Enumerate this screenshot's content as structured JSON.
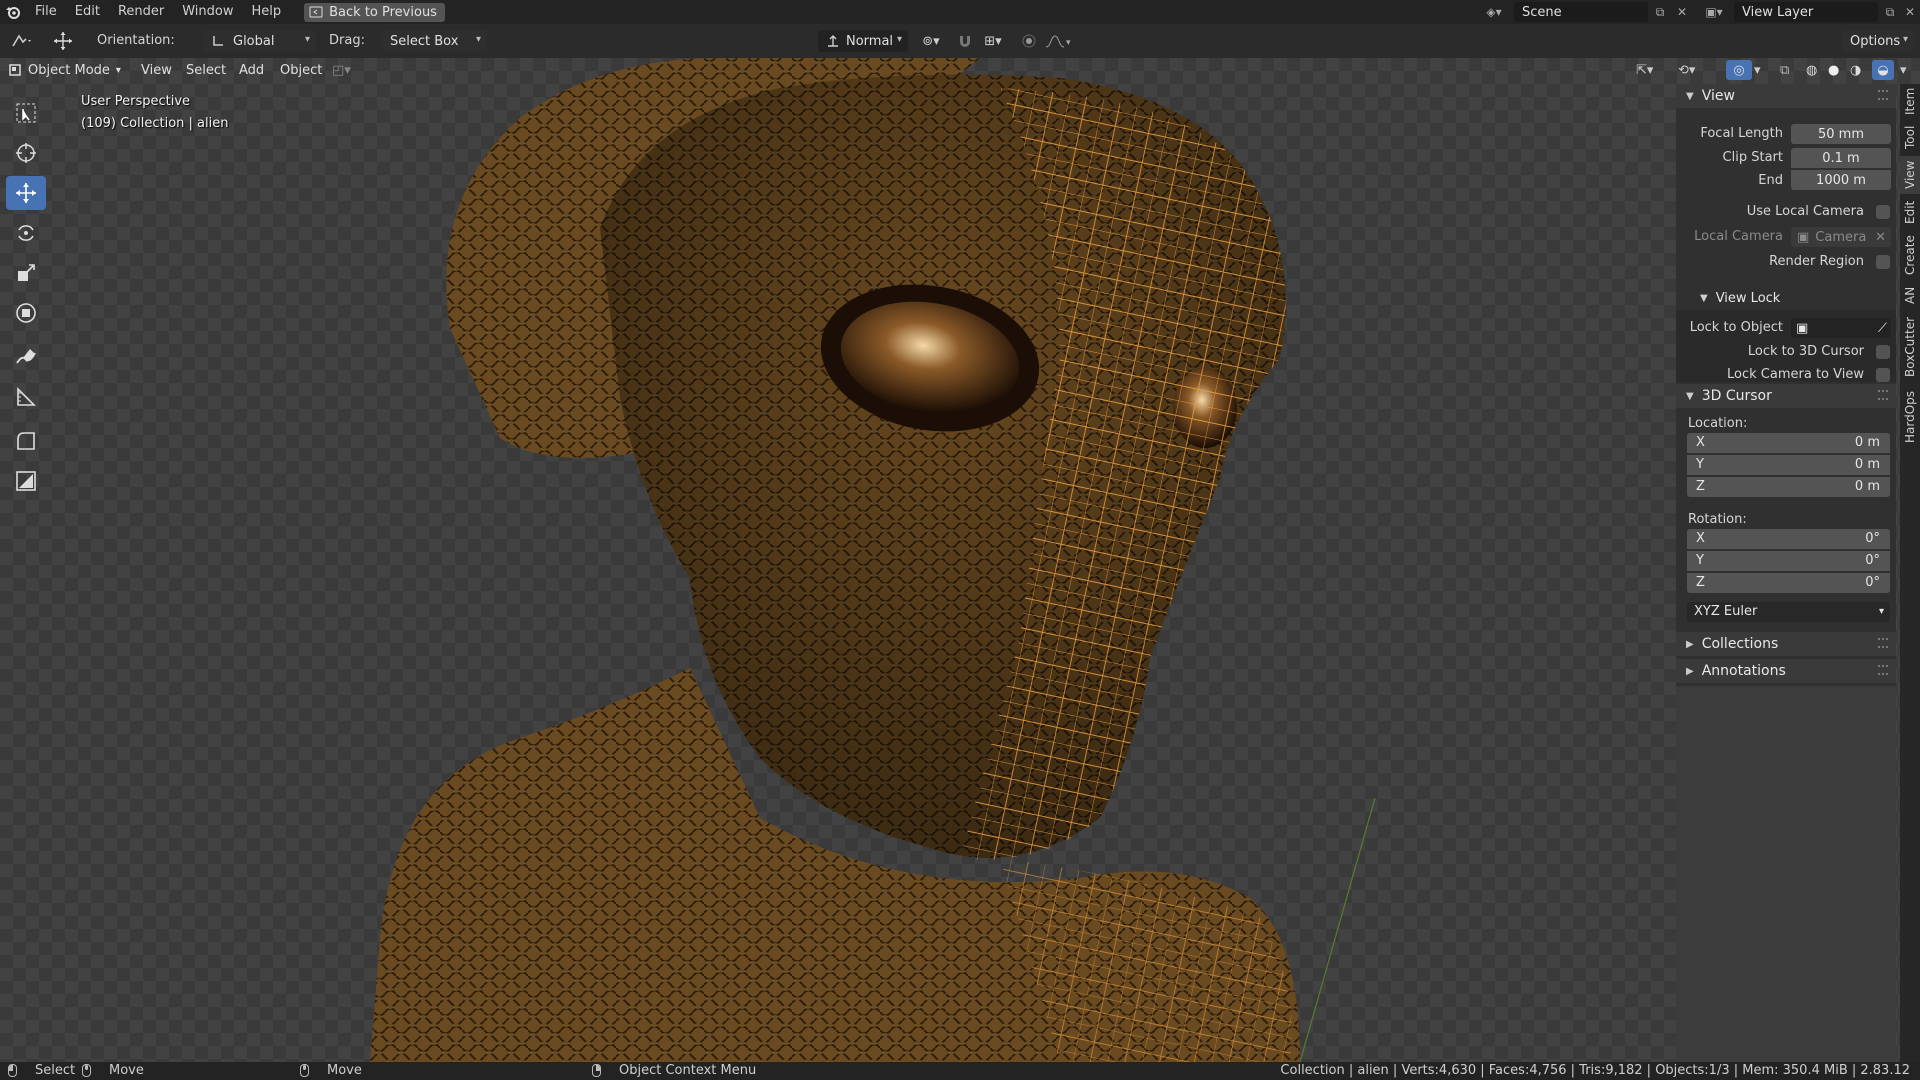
{
  "menubar": {
    "items": [
      "File",
      "Edit",
      "Render",
      "Window",
      "Help"
    ],
    "back_button": "Back to Previous",
    "scene": "Scene",
    "view_layer": "View Layer"
  },
  "toolheader": {
    "orientation_label": "Orientation:",
    "orientation_value": "Global",
    "drag_label": "Drag:",
    "drag_value": "Select Box",
    "transform_pivot": "Normal",
    "options": "Options"
  },
  "viewport": {
    "mode": "Object Mode",
    "menus": [
      "View",
      "Select",
      "Add",
      "Object"
    ],
    "overlay_line1": "User Perspective",
    "overlay_line2": "(109) Collection | alien"
  },
  "toolbar": {
    "tools": [
      "select-box-tool",
      "cursor-tool",
      "move-tool",
      "rotate-tool",
      "scale-tool",
      "transform-tool",
      "annotate-tool",
      "measure-tool",
      "add-cube-tool",
      "add-plane-tool"
    ],
    "active": "move-tool"
  },
  "npanel": {
    "tabs": [
      "Item",
      "Tool",
      "View",
      "Edit",
      "Create",
      "AN",
      "BoxCutter",
      "HardOps"
    ],
    "active_tab": "View",
    "view": {
      "title": "View",
      "focal_length_label": "Focal Length",
      "focal_length": "50 mm",
      "clip_start_label": "Clip Start",
      "clip_start": "0.1 m",
      "end_label": "End",
      "end": "1000 m",
      "use_local_camera": "Use Local Camera",
      "local_camera_label": "Local Camera",
      "local_camera_value": "Camera",
      "render_region": "Render Region"
    },
    "view_lock": {
      "title": "View Lock",
      "lock_to_object": "Lock to Object",
      "lock_to_cursor": "Lock to 3D Cursor",
      "lock_camera": "Lock Camera to View"
    },
    "cursor": {
      "title": "3D Cursor",
      "location_label": "Location:",
      "location": [
        {
          "axis": "X",
          "value": "0 m"
        },
        {
          "axis": "Y",
          "value": "0 m"
        },
        {
          "axis": "Z",
          "value": "0 m"
        }
      ],
      "rotation_label": "Rotation:",
      "rotation": [
        {
          "axis": "X",
          "value": "0°"
        },
        {
          "axis": "Y",
          "value": "0°"
        },
        {
          "axis": "Z",
          "value": "0°"
        }
      ],
      "rotation_mode": "XYZ Euler"
    },
    "collections": "Collections",
    "annotations": "Annotations"
  },
  "statusbar": {
    "select": "Select",
    "move": "Move",
    "move2": "Move",
    "context_menu": "Object Context Menu",
    "stats": "Collection | alien | Verts:4,630 | Faces:4,756 | Tris:9,182 | Objects:1/3 | Mem: 350.4 MiB | 2.83.12"
  },
  "colors": {
    "accent": "#4772b3",
    "wire": "#e8963a",
    "skin": "#6b4a22"
  }
}
